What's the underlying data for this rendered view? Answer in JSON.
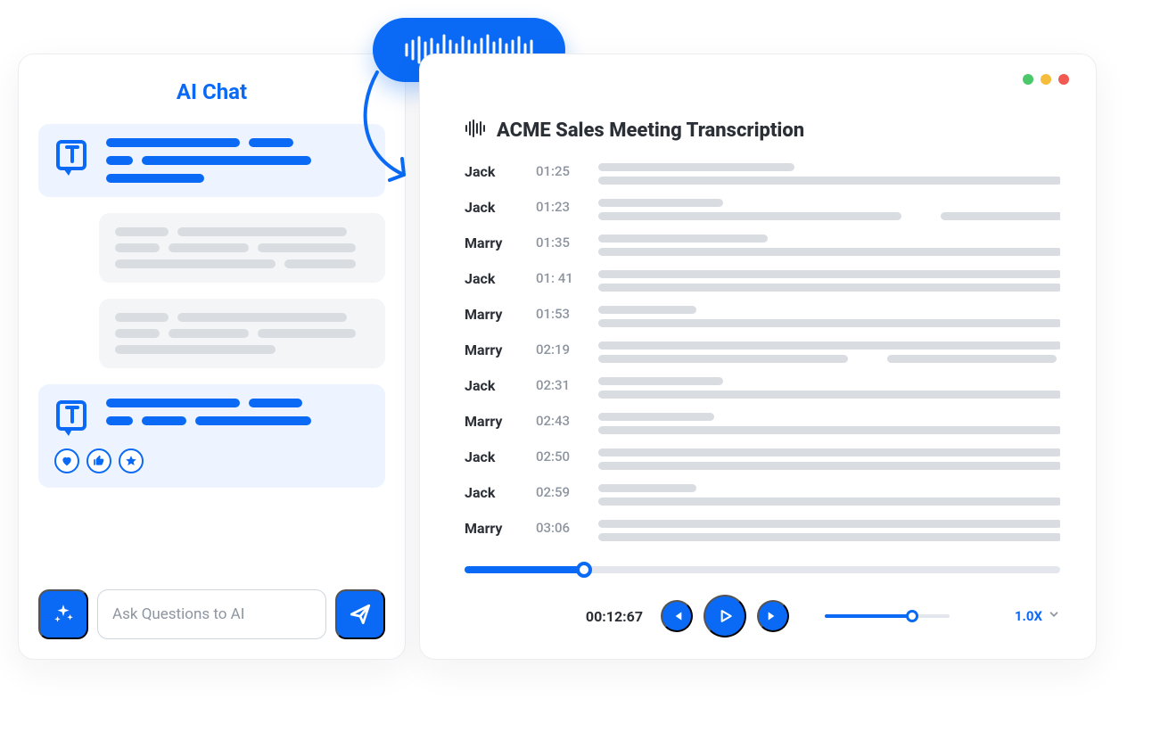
{
  "colors": {
    "primary": "#0a6af5",
    "muted": "#d9dce1",
    "text": "#2b2f36"
  },
  "chat": {
    "title": "AI Chat",
    "input_placeholder": "Ask Questions to AI",
    "icons": {
      "sparkle": "sparkle",
      "send": "send",
      "ai_avatar": "transcribe-T"
    },
    "reactions": [
      "heart",
      "thumbs-up",
      "star"
    ]
  },
  "audio_pill": {
    "icon": "waveform"
  },
  "transcription": {
    "title": "ACME Sales Meeting Transcription",
    "window_dots": [
      "#4bc96a",
      "#f6bc3b",
      "#f15a52"
    ],
    "rows": [
      {
        "speaker": "Jack",
        "time": "01:25"
      },
      {
        "speaker": "Jack",
        "time": "01:23"
      },
      {
        "speaker": "Marry",
        "time": "01:35"
      },
      {
        "speaker": "Jack",
        "time": "01: 41"
      },
      {
        "speaker": "Marry",
        "time": "01:53"
      },
      {
        "speaker": "Marry",
        "time": "02:19"
      },
      {
        "speaker": "Jack",
        "time": "02:31"
      },
      {
        "speaker": "Marry",
        "time": "02:43"
      },
      {
        "speaker": "Jack",
        "time": "02:50"
      },
      {
        "speaker": "Jack",
        "time": "02:59"
      },
      {
        "speaker": "Marry",
        "time": "03:06"
      }
    ],
    "player": {
      "current_time": "00:12:67",
      "progress_pct": 20,
      "volume_pct": 70,
      "speed_label": "1.0X"
    }
  }
}
